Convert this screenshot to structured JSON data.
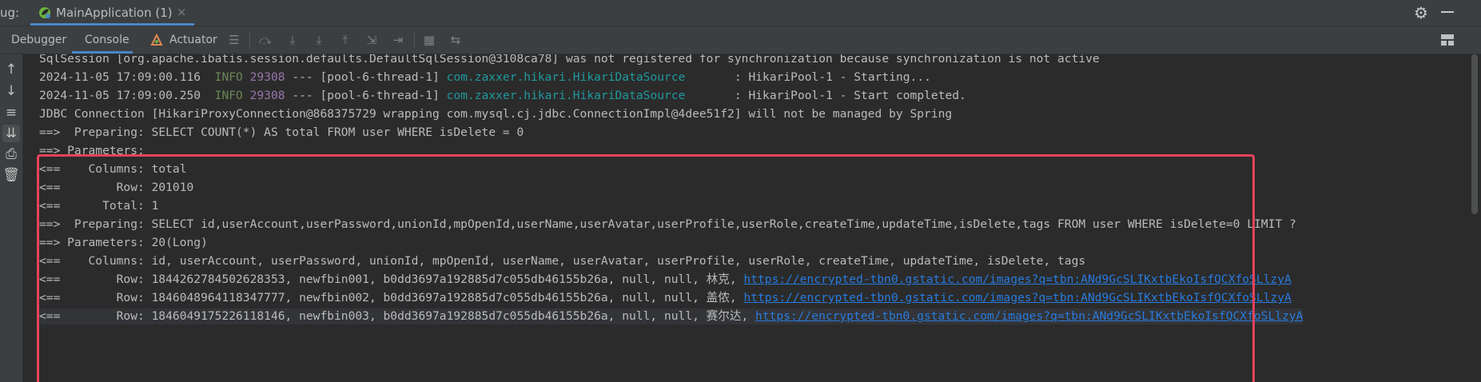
{
  "titlebar": {
    "label": "ug:",
    "run_tab_title": "MainApplication (1)",
    "close_glyph": "×"
  },
  "toolbar": {
    "tabs": [
      {
        "label": "Debugger",
        "active": false
      },
      {
        "label": "Console",
        "active": true
      },
      {
        "label": "Actuator",
        "active": false
      }
    ]
  },
  "console": {
    "lines": [
      {
        "text": "SqlSession [org.apache.ibatis.session.defaults.DefaultSqlSession@3108ca78] was not registered for synchronization because synchronization is not active"
      },
      {
        "ts": "2024-11-05 17:09:00.116",
        "level": "INFO",
        "pid": "29308",
        "mid": " --- [pool-6-thread-1] ",
        "cls": "com.zaxxer.hikari.HikariDataSource      ",
        "msg": " : HikariPool-1 - Starting..."
      },
      {
        "ts": "2024-11-05 17:09:00.250",
        "level": "INFO",
        "pid": "29308",
        "mid": " --- [pool-6-thread-1] ",
        "cls": "com.zaxxer.hikari.HikariDataSource      ",
        "msg": " : HikariPool-1 - Start completed."
      },
      {
        "text": "JDBC Connection [HikariProxyConnection@868375729 wrapping com.mysql.cj.jdbc.ConnectionImpl@4dee51f2] will not be managed by Spring"
      },
      {
        "text": "==>  Preparing: SELECT COUNT(*) AS total FROM user WHERE isDelete = 0"
      },
      {
        "text": "==> Parameters: "
      },
      {
        "text": "<==    Columns: total"
      },
      {
        "text": "<==        Row: 201010"
      },
      {
        "text": "<==      Total: 1"
      },
      {
        "text": "==>  Preparing: SELECT id,userAccount,userPassword,unionId,mpOpenId,userName,userAvatar,userProfile,userRole,createTime,updateTime,isDelete,tags FROM user WHERE isDelete=0 LIMIT ?"
      },
      {
        "text": "==> Parameters: 20(Long)"
      },
      {
        "text": "<==    Columns: id, userAccount, userPassword, unionId, mpOpenId, userName, userAvatar, userProfile, userRole, createTime, updateTime, isDelete, tags"
      },
      {
        "text": "<==        Row: 1844262784502628353, newfbin001, b0dd3697a192885d7c055db46155b26a, null, null, 林克, ",
        "link": "https://encrypted-tbn0.gstatic.com/images?q=tbn:ANd9GcSLIKxtbEkoIsfQCXfoSLlzyA"
      },
      {
        "text": "<==        Row: 1846048964118347777, newfbin002, b0dd3697a192885d7c055db46155b26a, null, null, 盖侬, ",
        "link": "https://encrypted-tbn0.gstatic.com/images?q=tbn:ANd9GcSLIKxtbEkoIsfQCXfoSLlzyA"
      },
      {
        "text": "<==        Row: 1846049175226118146, newfbin003, b0dd3697a192885d7c055db46155b26a, null, null, 赛尔达, ",
        "link": "https://encrypted-tbn0.gstatic.com/images?q=tbn:ANd9GcSLIKxtbEkoIsfQCXfoSLlzyA"
      }
    ]
  },
  "colors": {
    "info": "#6a8759",
    "pid": "#9876aa",
    "class": "#20999d",
    "link": "#287bde",
    "highlight_border": "#e5435b"
  },
  "icons": [
    "spring-run-icon",
    "settings-gear-icon",
    "minimize-icon",
    "actuator-icon",
    "restore-layout-icon",
    "scroll-up-icon",
    "scroll-down-icon",
    "soft-wrap-icon",
    "scroll-to-end-icon",
    "print-icon",
    "clear-all-icon"
  ]
}
